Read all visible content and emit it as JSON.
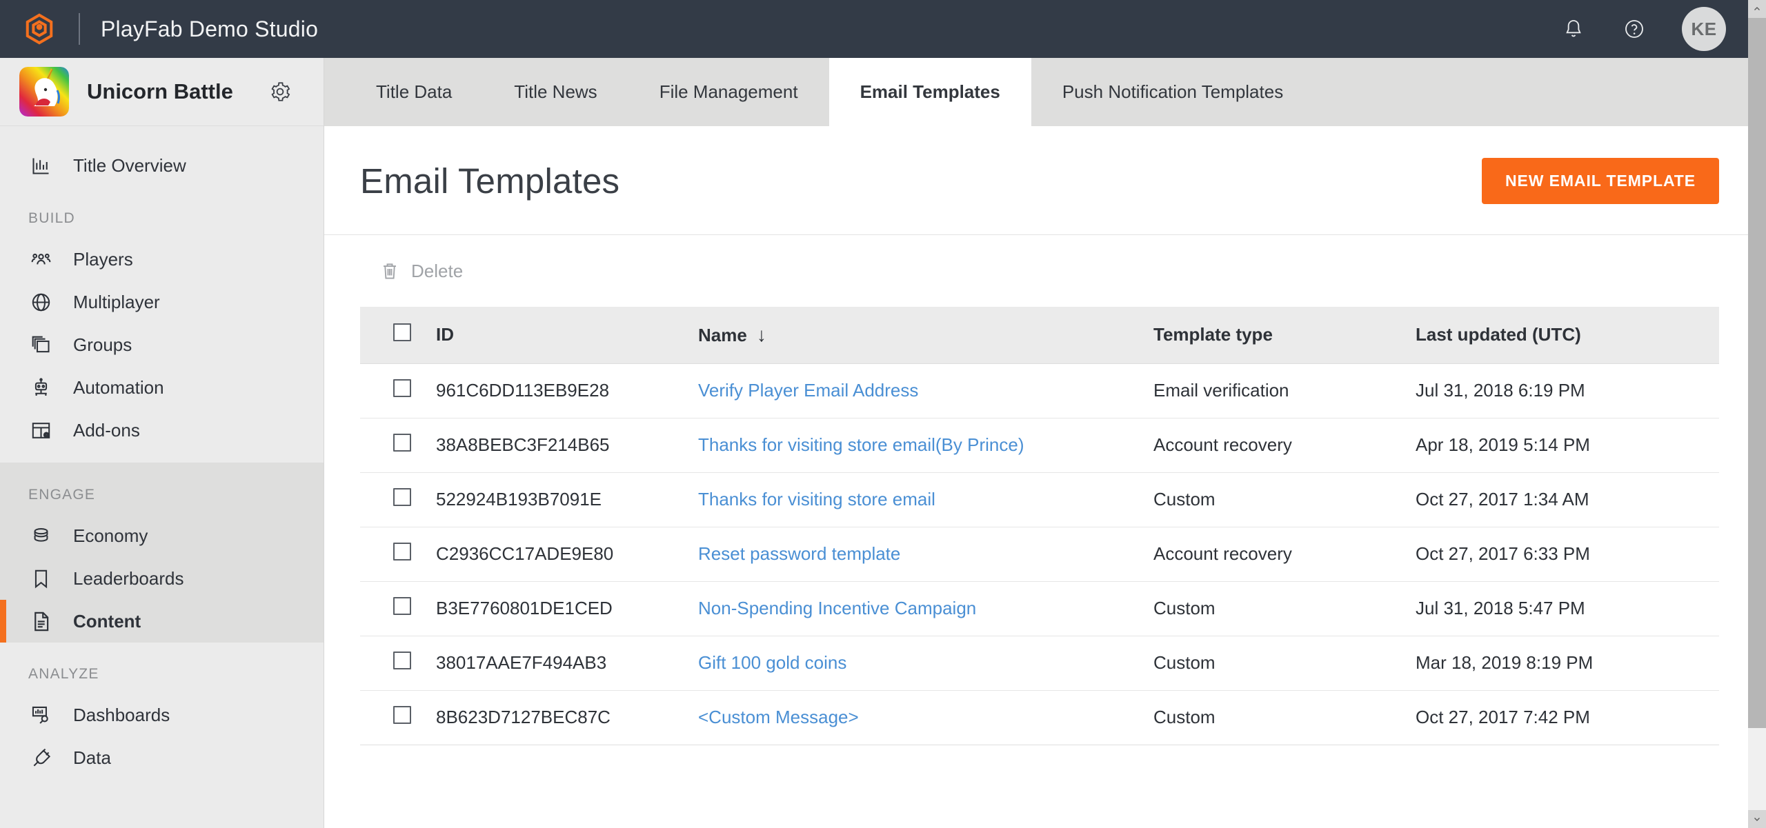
{
  "topbar": {
    "product_title": "PlayFab Demo Studio",
    "logo_icon": "playfab-hexagon-logo",
    "notifications_icon": "bell-icon",
    "help_icon": "question-circle-icon",
    "avatar_initials": "KE",
    "brand_orange": "#f4701e"
  },
  "sidebar": {
    "title_name": "Unicorn Battle",
    "title_thumb_icon": "unicorn-avatar",
    "settings_icon": "gear-icon",
    "overview": {
      "label": "Title Overview",
      "icon": "bar-chart-icon"
    },
    "sections": [
      {
        "label": "BUILD",
        "active": false,
        "items": [
          {
            "label": "Players",
            "icon": "people-icon",
            "active": false
          },
          {
            "label": "Multiplayer",
            "icon": "globe-icon",
            "active": false
          },
          {
            "label": "Groups",
            "icon": "stacked-windows-icon",
            "active": false
          },
          {
            "label": "Automation",
            "icon": "robot-icon",
            "active": false
          },
          {
            "label": "Add-ons",
            "icon": "table-gear-icon",
            "active": false
          }
        ]
      },
      {
        "label": "ENGAGE",
        "active": true,
        "items": [
          {
            "label": "Economy",
            "icon": "coins-stack-icon",
            "active": false
          },
          {
            "label": "Leaderboards",
            "icon": "bookmark-icon",
            "active": false
          },
          {
            "label": "Content",
            "icon": "document-icon",
            "active": true
          }
        ]
      },
      {
        "label": "ANALYZE",
        "active": false,
        "items": [
          {
            "label": "Dashboards",
            "icon": "chart-search-icon",
            "active": false
          },
          {
            "label": "Data",
            "icon": "plug-icon",
            "active": false
          }
        ]
      }
    ]
  },
  "tabs": [
    {
      "label": "Title Data",
      "active": false
    },
    {
      "label": "Title News",
      "active": false
    },
    {
      "label": "File Management",
      "active": false
    },
    {
      "label": "Email Templates",
      "active": true
    },
    {
      "label": "Push Notification Templates",
      "active": false
    }
  ],
  "page": {
    "title": "Email Templates",
    "primary_button": "NEW EMAIL TEMPLATE"
  },
  "toolbar": {
    "delete_label": "Delete",
    "delete_icon": "trash-icon"
  },
  "table": {
    "select_all_checked": false,
    "sort_column": "Name",
    "sort_direction_glyph": "↓",
    "columns": [
      "ID",
      "Name",
      "Template type",
      "Last updated (UTC)"
    ],
    "rows": [
      {
        "checked": false,
        "id": "961C6DD113EB9E28",
        "name": "Verify Player Email Address",
        "type": "Email verification",
        "updated": "Jul 31, 2018 6:19 PM"
      },
      {
        "checked": false,
        "id": "38A8BEBC3F214B65",
        "name": "Thanks for visiting store email(By Prince)",
        "type": "Account recovery",
        "updated": "Apr 18, 2019 5:14 PM"
      },
      {
        "checked": false,
        "id": "522924B193B7091E",
        "name": "Thanks for visiting store email",
        "type": "Custom",
        "updated": "Oct 27, 2017 1:34 AM"
      },
      {
        "checked": false,
        "id": "C2936CC17ADE9E80",
        "name": "Reset password template",
        "type": "Account recovery",
        "updated": "Oct 27, 2017 6:33 PM"
      },
      {
        "checked": false,
        "id": "B3E7760801DE1CED",
        "name": "Non-Spending Incentive Campaign",
        "type": "Custom",
        "updated": "Jul 31, 2018 5:47 PM"
      },
      {
        "checked": false,
        "id": "38017AAE7F494AB3",
        "name": "Gift 100 gold coins",
        "type": "Custom",
        "updated": "Mar 18, 2019 8:19 PM"
      },
      {
        "checked": false,
        "id": "8B623D7127BEC87C",
        "name": "<Custom Message>",
        "type": "Custom",
        "updated": "Oct 27, 2017 7:42 PM"
      }
    ]
  },
  "scrollbar": {
    "up_icon": "chevron-up-icon",
    "down_icon": "chevron-down-icon"
  },
  "colors": {
    "accent_orange": "#f96919",
    "link_blue": "#4a8fd4",
    "topbar_dark": "#333b47",
    "sidebar_bg": "#ebebeb"
  }
}
